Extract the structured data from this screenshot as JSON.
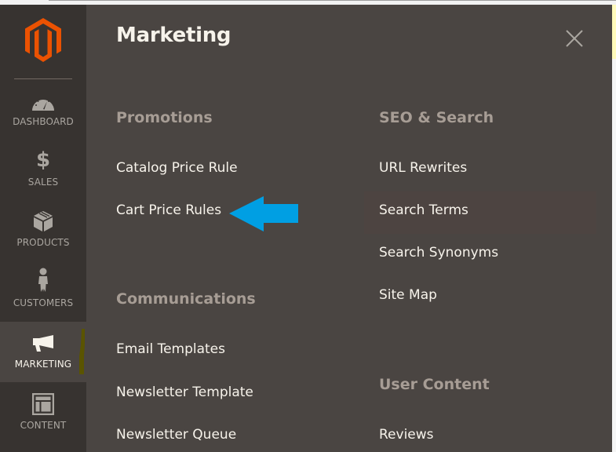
{
  "colors": {
    "sidebar_bg": "#373330",
    "panel_bg": "#4a4542",
    "logo_orange": "#eb5202",
    "arrow_blue": "#009fe3",
    "section_title": "#a79d95",
    "link_text": "#f7f3eb",
    "marker": "#5a5400"
  },
  "sidebar": {
    "logo": "magento-logo",
    "items": [
      {
        "id": "dashboard",
        "label": "DASHBOARD",
        "icon": "dashboard-gauge-icon",
        "active": false
      },
      {
        "id": "sales",
        "label": "SALES",
        "icon": "dollar-icon",
        "active": false
      },
      {
        "id": "products",
        "label": "PRODUCTS",
        "icon": "box-icon",
        "active": false
      },
      {
        "id": "customers",
        "label": "CUSTOMERS",
        "icon": "person-icon",
        "active": false
      },
      {
        "id": "marketing",
        "label": "MARKETING",
        "icon": "megaphone-icon",
        "active": true
      },
      {
        "id": "content",
        "label": "CONTENT",
        "icon": "layout-icon",
        "active": false
      }
    ]
  },
  "panel": {
    "title": "Marketing",
    "close_icon": "close-icon",
    "sections": [
      {
        "title": "Promotions",
        "links": [
          "Catalog Price Rule",
          "Cart Price Rules"
        ]
      },
      {
        "title": "Communications",
        "links": [
          "Email Templates",
          "Newsletter Template",
          "Newsletter Queue"
        ]
      },
      {
        "title": "SEO & Search",
        "links": [
          "URL Rewrites",
          "Search Terms",
          "Search Synonyms",
          "Site Map"
        ]
      },
      {
        "title": "User Content",
        "links": [
          "Reviews"
        ]
      }
    ],
    "hovered_link": "Search Terms",
    "annotation": {
      "type": "arrow",
      "points_to": "Cart Price Rules",
      "icon": "left-arrow-annotation-icon"
    }
  }
}
